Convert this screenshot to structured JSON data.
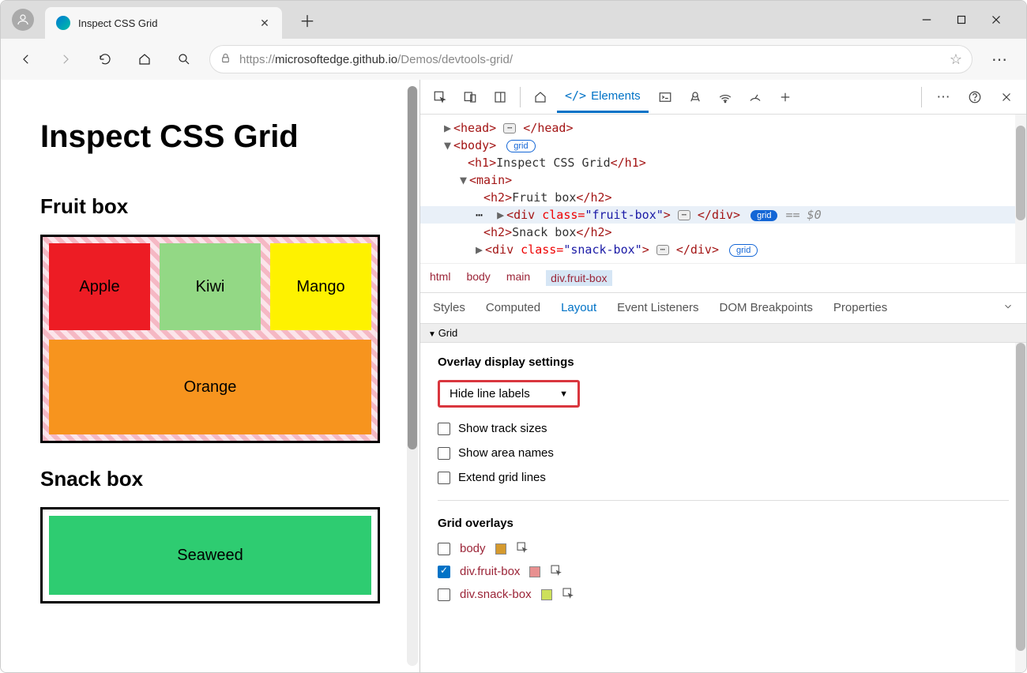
{
  "browser": {
    "tab_title": "Inspect CSS Grid",
    "url_protocol": "https://",
    "url_host": "microsoftedge.github.io",
    "url_path": "/Demos/devtools-grid/"
  },
  "page": {
    "h1": "Inspect CSS Grid",
    "section1": "Fruit box",
    "fruits": {
      "apple": "Apple",
      "kiwi": "Kiwi",
      "mango": "Mango",
      "orange": "Orange"
    },
    "section2": "Snack box",
    "snacks": {
      "seaweed": "Seaweed"
    }
  },
  "devtools": {
    "tabs": {
      "elements": "Elements"
    },
    "dom": {
      "head_open": "<head>",
      "head_close": "</head>",
      "body_open": "<body>",
      "grid_badge": "grid",
      "h1_open": "<h1>",
      "h1_text": "Inspect CSS Grid",
      "h1_close": "</h1>",
      "main_open": "<main>",
      "h2f_open": "<h2>",
      "h2f_text": "Fruit box",
      "h2f_close": "</h2>",
      "divf_open": "<div ",
      "divf_attr_n": "class=",
      "divf_attr_v": "\"fruit-box\"",
      "divf_mid": ">",
      "divf_close": "</div>",
      "divf_var": "== $0",
      "h2s_open": "<h2>",
      "h2s_text": "Snack box",
      "h2s_close": "</h2>",
      "divs_open": "<div ",
      "divs_attr_n": "class=",
      "divs_attr_v": "\"snack-box\"",
      "divs_mid": ">",
      "divs_close": "</div>"
    },
    "breadcrumb": [
      "html",
      "body",
      "main",
      "div.fruit-box"
    ],
    "panel_tabs": [
      "Styles",
      "Computed",
      "Layout",
      "Event Listeners",
      "DOM Breakpoints",
      "Properties"
    ],
    "grid_header": "Grid",
    "overlay": {
      "title": "Overlay display settings",
      "dropdown": "Hide line labels",
      "opt_track": "Show track sizes",
      "opt_area": "Show area names",
      "opt_extend": "Extend grid lines"
    },
    "overlays": {
      "title": "Grid overlays",
      "items": [
        {
          "selector": "body",
          "color": "#d59a2e",
          "checked": false
        },
        {
          "selector": "div.fruit-box",
          "color": "#e89090",
          "checked": true
        },
        {
          "selector": "div.snack-box",
          "color": "#cde05a",
          "checked": false
        }
      ]
    }
  }
}
